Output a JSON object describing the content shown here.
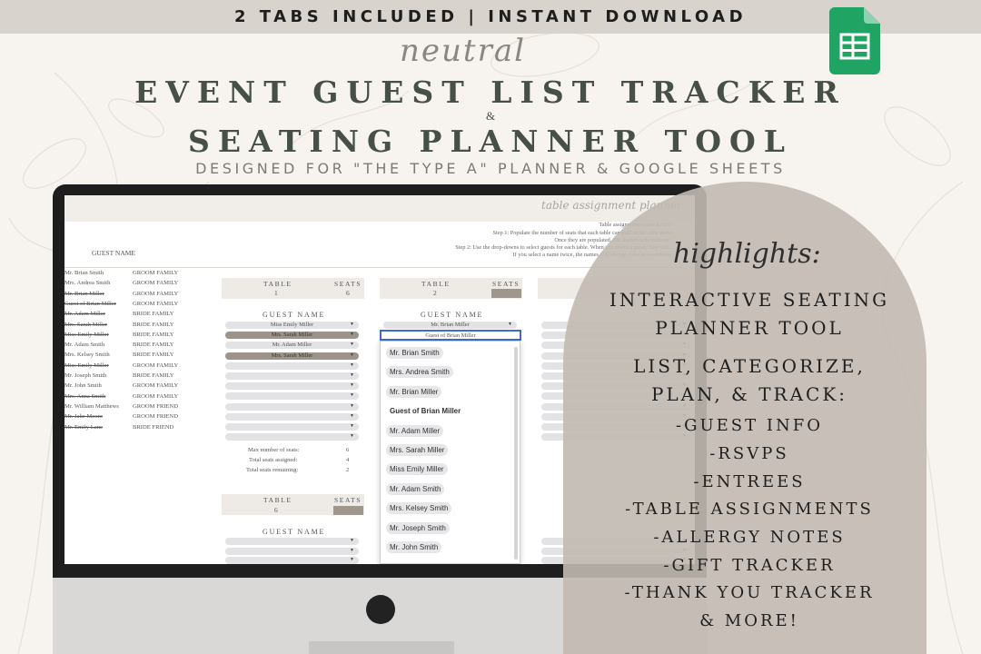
{
  "banner": {
    "text": "2 TABS INCLUDED | INSTANT DOWNLOAD"
  },
  "header": {
    "script_word": "neutral",
    "title_line1": "EVENT GUEST LIST TRACKER",
    "ampersand": "&",
    "title_line2": "SEATING PLANNER TOOL",
    "subtitle": "DESIGNED FOR \"THE TYPE A\" PLANNER & GOOGLE SHEETS"
  },
  "app_icon": {
    "name": "google-sheets-icon",
    "color": "#1fa463"
  },
  "screen": {
    "sheet_title": "table assignment planner",
    "instructions": [
      "Table assignments made EASY!",
      "Step 1: Populate the number of seats that each table can hold in the cells above",
      "Once they are populated, the shaded cells indicate...",
      "Step 2: Use the drop-downs to select guests for each table. When you select a guest, they will...",
      "If you select a name twice, the names will change color as a reminder."
    ],
    "guest_name_header": "GUEST NAME",
    "guests": [
      {
        "name": "Mr. Brian Smith",
        "family": "GROOM FAMILY",
        "struck": false
      },
      {
        "name": "Mrs. Andrea Smith",
        "family": "GROOM FAMILY",
        "struck": false
      },
      {
        "name": "Mr. Brian Miller",
        "family": "GROOM FAMILY",
        "struck": true
      },
      {
        "name": "Guest of Brian Miller",
        "family": "GROOM FAMILY",
        "struck": true
      },
      {
        "name": "Mr. Adam Miller",
        "family": "BRIDE FAMILY",
        "struck": true
      },
      {
        "name": "Mrs. Sarah Miller",
        "family": "BRIDE FAMILY",
        "struck": true
      },
      {
        "name": "Miss Emily Miller",
        "family": "BRIDE FAMILY",
        "struck": true
      },
      {
        "name": "Mr. Adam Smith",
        "family": "BRIDE FAMILY",
        "struck": false
      },
      {
        "name": "Mrs. Kelsey Smith",
        "family": "BRIDE FAMILY",
        "struck": false
      },
      {
        "name": "Miss Emily Miller",
        "family": "GROOM FAMILY",
        "struck": true
      },
      {
        "name": "Mr. Joseph Smith",
        "family": "BRIDE FAMILY",
        "struck": false
      },
      {
        "name": "Mr. John Smith",
        "family": "GROOM FAMILY",
        "struck": false
      },
      {
        "name": "Mrs. Anna Smith",
        "family": "GROOM FAMILY",
        "struck": true
      },
      {
        "name": "Mr. William Matthews",
        "family": "GROOM FRIEND",
        "struck": false
      },
      {
        "name": "Mr. Jake Moore",
        "family": "GROOM FRIEND",
        "struck": true
      },
      {
        "name": "Mr. Emily Lane",
        "family": "BRIDE FRIEND",
        "struck": true
      }
    ],
    "table1": {
      "table_label": "TABLE",
      "table_num": "1",
      "seats_label": "SEATS",
      "seats_num": "6",
      "guest_name_label": "GUEST NAME",
      "assigned": [
        "Miss Emily Miller",
        "Mrs. Sarah Miller",
        "Mr. Adam Miller",
        "Mrs. Sarah Miller"
      ],
      "stats": {
        "max_label": "Max number of seats:",
        "max_value": "6",
        "assigned_label": "Total seats assigned:",
        "assigned_value": "4",
        "remaining_label": "Total seats remaining:",
        "remaining_value": "2"
      }
    },
    "table2": {
      "table_label": "TABLE",
      "table_num": "2",
      "seats_label": "SEATS",
      "guest_name_label": "GUEST NAME",
      "assigned": [
        "Mr. Brian Miller"
      ],
      "input_value": "Guest of Brian Miller"
    },
    "table6": {
      "table_label": "TABLE",
      "table_num": "6",
      "seats_label": "SEATS",
      "guest_name_label": "GUEST NAME"
    },
    "dropdown_options": [
      "Mr. Brian Smith",
      "Mrs. Andrea Smith",
      "Mr. Brian Miller",
      "Guest of Brian Miller",
      "Mr. Adam Miller",
      "Mrs. Sarah Miller",
      "Miss Emily Miller",
      "Mr. Adam Smith",
      "Mrs. Kelsey Smith",
      "Mr. Joseph Smith",
      "Mr. John Smith"
    ],
    "dropdown_selected_index": 3
  },
  "highlights": {
    "title": "highlights:",
    "lines": [
      "INTERACTIVE SEATING",
      "PLANNER TOOL",
      "LIST, CATEGORIZE,",
      "PLAN, & TRACK:",
      "-GUEST INFO",
      "-RSVPS",
      "-ENTREES",
      "-TABLE ASSIGNMENTS",
      "-ALLERGY NOTES",
      "-GIFT TRACKER",
      "-THANK YOU TRACKER",
      "& MORE!"
    ]
  },
  "colors": {
    "banner": "#d8d3cc",
    "title": "#465048",
    "arch": "#c1b9b1",
    "seat_fill": "#a0978c"
  }
}
